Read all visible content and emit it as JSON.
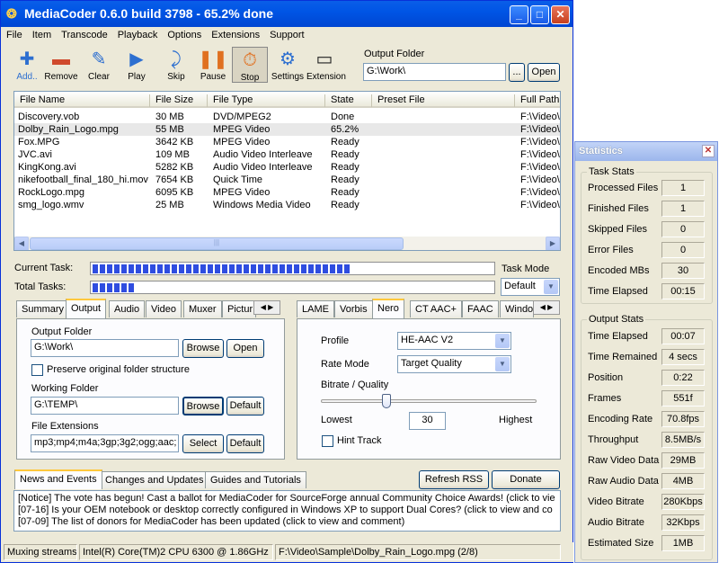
{
  "window": {
    "title": "MediaCoder 0.6.0 build 3798 - 65.2% done"
  },
  "menu": [
    "File",
    "Item",
    "Transcode",
    "Playback",
    "Options",
    "Extensions",
    "Support"
  ],
  "toolbar": [
    {
      "label": "Add..",
      "icon": "add-icon",
      "glyph": "✚"
    },
    {
      "label": "Remove",
      "icon": "remove-icon",
      "glyph": "▬"
    },
    {
      "label": "Clear",
      "icon": "clear-icon",
      "glyph": "✎"
    },
    {
      "label": "Play",
      "icon": "play-icon",
      "glyph": "▶"
    },
    {
      "label": "Skip",
      "icon": "skip-icon",
      "glyph": "⤸"
    },
    {
      "label": "Pause",
      "icon": "pause-icon",
      "glyph": "❚❚"
    },
    {
      "label": "Stop",
      "icon": "stop-icon",
      "glyph": "⏱"
    },
    {
      "label": "Settings",
      "icon": "settings-icon",
      "glyph": "⚙"
    },
    {
      "label": "Extension",
      "icon": "extension-icon",
      "glyph": "▭"
    }
  ],
  "output_folder": {
    "label": "Output Folder",
    "value": "G:\\Work\\",
    "browse": "...",
    "open": "Open"
  },
  "files": {
    "columns": [
      "File Name",
      "File Size",
      "File Type",
      "State",
      "Preset File",
      "Full Path"
    ],
    "rows": [
      {
        "name": "Discovery.vob",
        "size": "30 MB",
        "type": "DVD/MPEG2",
        "state": "Done",
        "preset": "",
        "path": "F:\\Video\\"
      },
      {
        "name": "Dolby_Rain_Logo.mpg",
        "size": "55 MB",
        "type": "MPEG Video",
        "state": "65.2%",
        "preset": "",
        "path": "F:\\Video\\"
      },
      {
        "name": "Fox.MPG",
        "size": "3642 KB",
        "type": "MPEG Video",
        "state": "Ready",
        "preset": "",
        "path": "F:\\Video\\"
      },
      {
        "name": "JVC.avi",
        "size": "109 MB",
        "type": "Audio Video Interleave",
        "state": "Ready",
        "preset": "",
        "path": "F:\\Video\\"
      },
      {
        "name": "KingKong.avi",
        "size": "5282 KB",
        "type": "Audio Video Interleave",
        "state": "Ready",
        "preset": "",
        "path": "F:\\Video\\"
      },
      {
        "name": "nikefootball_final_180_hi.mov",
        "size": "7654 KB",
        "type": "Quick Time",
        "state": "Ready",
        "preset": "",
        "path": "F:\\Video\\"
      },
      {
        "name": "RockLogo.mpg",
        "size": "6095 KB",
        "type": "MPEG Video",
        "state": "Ready",
        "preset": "",
        "path": "F:\\Video\\"
      },
      {
        "name": "smg_logo.wmv",
        "size": "25 MB",
        "type": "Windows Media Video",
        "state": "Ready",
        "preset": "",
        "path": "F:\\Video\\"
      }
    ]
  },
  "progress": {
    "current_label": "Current Task:",
    "current_fraction": 0.652,
    "total_label": "Total Tasks:",
    "total_fraction": 0.11
  },
  "task_mode": {
    "label": "Task Mode",
    "value": "Default"
  },
  "left_tabs": [
    "Summary",
    "Output",
    "Audio",
    "Video",
    "Muxer",
    "Pictur"
  ],
  "left_panel": {
    "output_folder_label": "Output Folder",
    "output_folder_value": "G:\\Work\\",
    "browse": "Browse",
    "open": "Open",
    "preserve_label": "Preserve original folder structure",
    "working_folder_label": "Working Folder",
    "working_folder_value": "G:\\TEMP\\",
    "browse2": "Browse",
    "default1": "Default",
    "file_ext_label": "File Extensions",
    "file_ext_value": "mp3;mp4;m4a;3gp;3g2;ogg;aac;",
    "select": "Select",
    "default2": "Default"
  },
  "right_tabs": [
    "LAME",
    "Vorbis",
    "Nero",
    "CT AAC+",
    "FAAC",
    "Windo"
  ],
  "right_panel": {
    "profile_label": "Profile",
    "profile_value": "HE-AAC V2",
    "rate_mode_label": "Rate Mode",
    "rate_mode_value": "Target Quality",
    "bitrate_label": "Bitrate / Quality",
    "lowest": "Lowest",
    "quality_value": "30",
    "highest": "Highest",
    "hint_track": "Hint Track"
  },
  "bottom_tabs": [
    "News and Events",
    "Changes and Updates",
    "Guides and Tutorials"
  ],
  "refresh_rss": "Refresh RSS",
  "donate": "Donate",
  "news": [
    "[Notice] The vote has begun! Cast a ballot for MediaCoder for SourceForge annual Community Choice Awards! (click to vie",
    "[07-16] Is your OEM notebook or desktop correctly configured in Windows XP to support Dual Cores? (click to view and co",
    "[07-09] The list of donors for MediaCoder has been updated (click to view and comment)"
  ],
  "status": {
    "state": "Muxing streams",
    "cpu": "Intel(R) Core(TM)2 CPU 6300 @ 1.86GHz",
    "file": "F:\\Video\\Sample\\Dolby_Rain_Logo.mpg (2/8)"
  },
  "stats": {
    "title": "Statistics",
    "task_group": "Task Stats",
    "task": [
      {
        "label": "Processed Files",
        "value": "1"
      },
      {
        "label": "Finished Files",
        "value": "1"
      },
      {
        "label": "Skipped Files",
        "value": "0"
      },
      {
        "label": "Error Files",
        "value": "0"
      },
      {
        "label": "Encoded MBs",
        "value": "30"
      },
      {
        "label": "Time Elapsed",
        "value": "00:15"
      }
    ],
    "output_group": "Output Stats",
    "output": [
      {
        "label": "Time Elapsed",
        "value": "00:07"
      },
      {
        "label": "Time Remained",
        "value": "4 secs"
      },
      {
        "label": "Position",
        "value": "0:22"
      },
      {
        "label": "Frames",
        "value": "551f"
      },
      {
        "label": "Encoding Rate",
        "value": "70.8fps"
      },
      {
        "label": "Throughput",
        "value": "8.5MB/s"
      },
      {
        "label": "Raw Video Data",
        "value": "29MB"
      },
      {
        "label": "Raw Audio Data",
        "value": "4MB"
      },
      {
        "label": "Video Bitrate",
        "value": "280Kbps"
      },
      {
        "label": "Audio Bitrate",
        "value": "32Kbps"
      },
      {
        "label": "Estimated Size",
        "value": "1MB"
      }
    ]
  },
  "colors": {
    "title_blue": "#0055e5",
    "progress_blue": "#2f4de0",
    "tab_highlight": "#ffc83c"
  }
}
